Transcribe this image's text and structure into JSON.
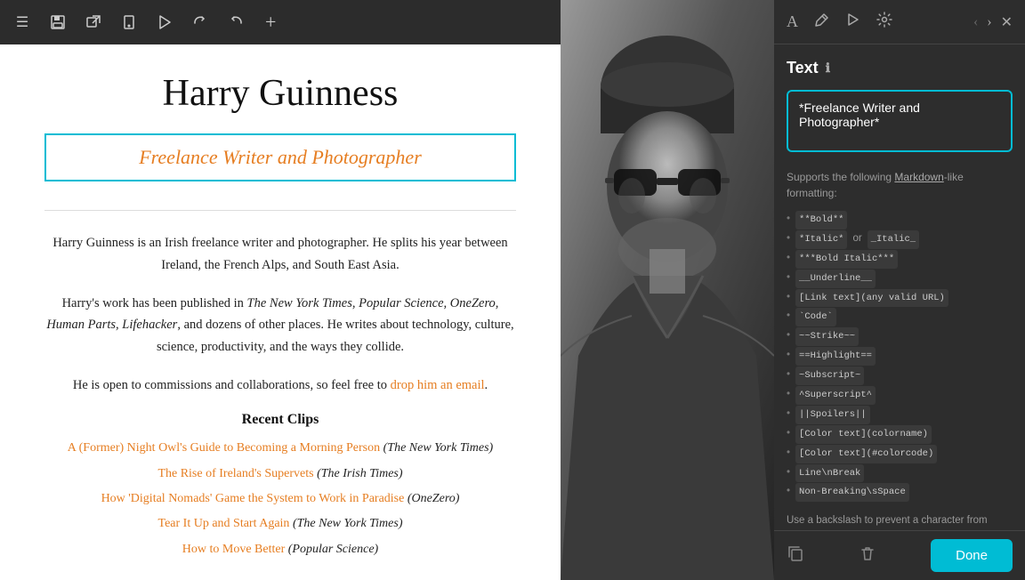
{
  "toolbar": {
    "icons": [
      "menu",
      "save",
      "share",
      "device",
      "play",
      "redo",
      "undo",
      "add"
    ]
  },
  "content": {
    "page_title": "Harry Guinness",
    "subtitle": "Freelance Writer and Photographer",
    "bio_paragraph1": "Harry Guinness is an Irish freelance writer and photographer. He splits his year between Ireland, the French Alps, and South East Asia.",
    "bio_paragraph2_start": "Harry's work has been published in ",
    "bio_paragraph2_pubs": "The New York Times, Popular Science, OneZero, Human Parts, Lifehacker",
    "bio_paragraph2_end": ", and dozens of other places. He writes about technology, culture, science, productivity, and the ways they collide.",
    "bio_paragraph3_start": "He is open to commissions and collaborations, so feel free to ",
    "bio_paragraph3_link": "drop him an email",
    "bio_paragraph3_end": ".",
    "section_title": "Recent Clips",
    "clips": [
      {
        "title": "A (Former) Night Owl's Guide to Becoming a Morning Person",
        "publication": "The New York Times"
      },
      {
        "title": "The Rise of Ireland's Supervets",
        "publication": "The Irish Times"
      },
      {
        "title": "How 'Digital Nomads' Game the System to Work in Paradise",
        "publication": "OneZero"
      },
      {
        "title": "Tear It Up and Start Again",
        "publication": "The New York Times"
      },
      {
        "title": "How to Move Better",
        "publication": "Popular Science"
      }
    ]
  },
  "right_panel": {
    "title": "Text",
    "text_value": "*Freelance Writer and Photographer*",
    "markdown_intro": "Supports the following Markdown-like formatting:",
    "markdown_items": [
      "**Bold**",
      "*Italic* or _Italic_",
      "***Bold Italic***",
      "__Underline__",
      "[Link text](any valid URL)",
      "`Code`",
      "~~Strike~~",
      "==Highlight==",
      "~Subscript~",
      "^Superscript^",
      "||Spoilers||",
      "[Color text](colorname)",
      "[Color text](#colorcode)",
      "Line\\nBreak",
      "Non-Breaking\\sSpace"
    ],
    "backslash_info": "Use a backslash to prevent a character from being parsed as Markdown (eg. \\ ).",
    "done_label": "Done"
  }
}
